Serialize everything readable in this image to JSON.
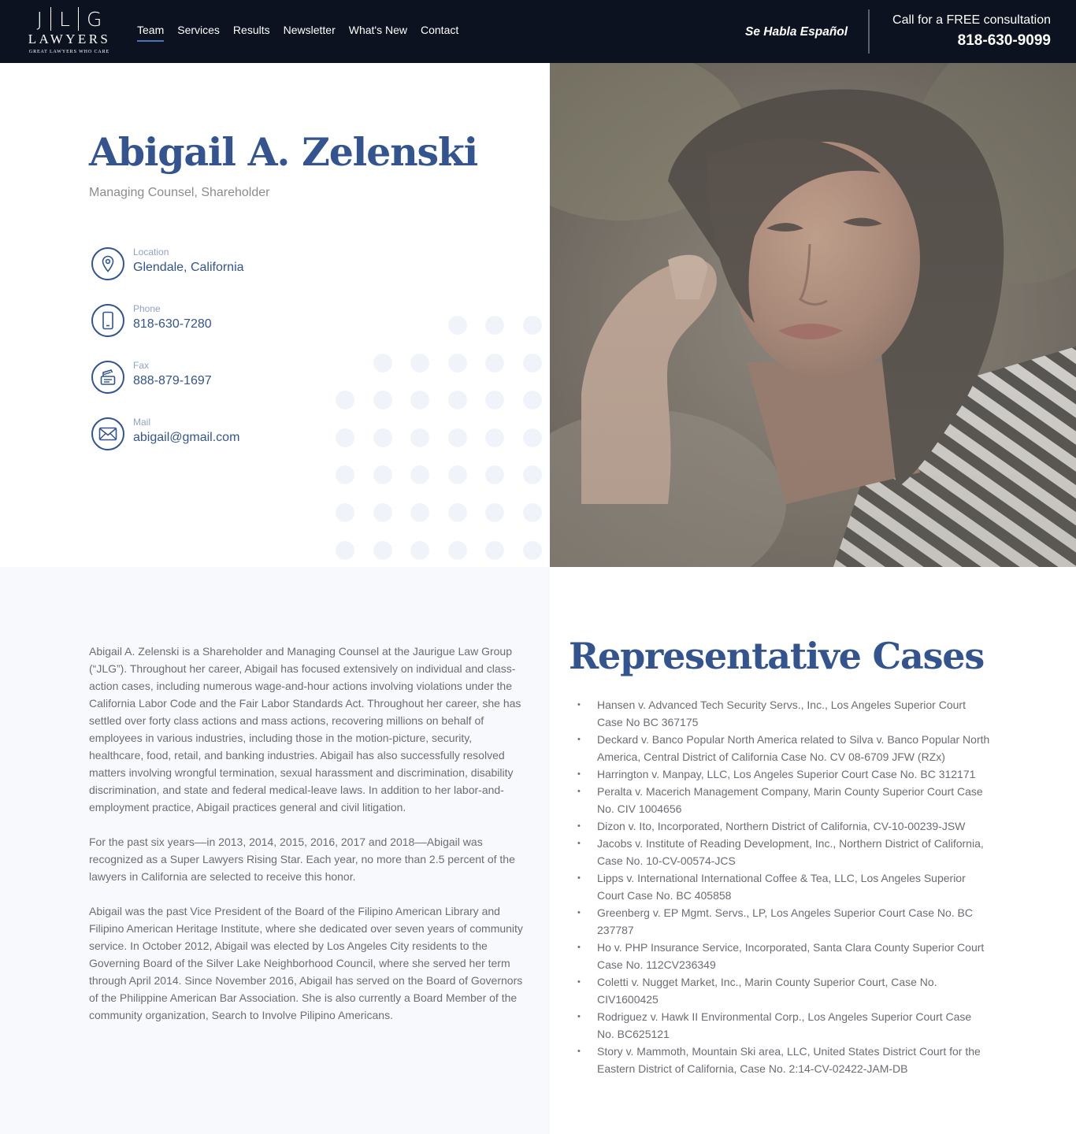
{
  "header": {
    "logo": {
      "mark_left": "J",
      "mark_center": "L",
      "mark_right": "G",
      "word": "LAWYERS",
      "tagline": "GREAT LAWYERS WHO CARE"
    },
    "nav": [
      {
        "label": "Team",
        "active": true
      },
      {
        "label": "Services"
      },
      {
        "label": "Results"
      },
      {
        "label": "Newsletter"
      },
      {
        "label": "What's New"
      },
      {
        "label": "Contact"
      }
    ],
    "spanish": "Se Habla Español",
    "cta_label": "Call for a FREE consultation",
    "cta_phone": "818-630-9099"
  },
  "profile": {
    "name": "Abigail A. Zelenski",
    "title": "Managing Counsel, Shareholder",
    "contacts": [
      {
        "label": "Location",
        "value": "Glendale, California",
        "icon": "location-pin-icon"
      },
      {
        "label": "Phone",
        "value": "818-630-7280",
        "icon": "mobile-phone-icon"
      },
      {
        "label": "Fax",
        "value": "888-879-1697",
        "icon": "fax-icon"
      },
      {
        "label": "Mail",
        "value": "abigail@gmail.com",
        "icon": "envelope-icon"
      }
    ]
  },
  "bio": [
    "Abigail A. Zelenski is a Shareholder and Managing Counsel at the Jaurigue Law Group (“JLG”). Throughout her career, Abigail has focused extensively on individual and class-action cases, including numerous wage-and-hour actions involving violations under the California Labor Code and the Fair Labor Standards Act. Throughout her career, she has settled over forty class actions and mass actions, recovering millions on behalf of employees in various industries, including those in the motion-picture, security, healthcare, food, retail, and banking industries. Abigail has also successfully resolved matters involving wrongful termination, sexual harassment and discrimination, disability discrimination, and state and federal medical-leave laws. In addition to her labor-and-employment practice, Abigail practices general and civil litigation.",
    "For the past six years––in 2013, 2014, 2015, 2016, 2017 and 2018––Abigail was recognized as a Super Lawyers Rising Star. Each year, no more than 2.5 percent of the lawyers in California are selected to receive this honor.",
    "Abigail was the past Vice President of the Board of the Filipino American Library and Filipino American Heritage Institute, where she dedicated over seven years of community service. In October 2012, Abigail was elected by Los Angeles City residents to the Governing Board of the Silver Lake Neighborhood Council, where she served her term through April 2014. Since November 2016, Abigail has served on the Board of Governors of the Philippine American Bar Association. She is also currently a Board Member of the community organization, Search to Involve Pilipino Americans."
  ],
  "cases": {
    "title": "Representative Cases",
    "items": [
      "Hansen v. Advanced Tech Security Servs., Inc., Los Angeles Superior Court Case No BC 367175",
      "Deckard v. Banco Popular North America related to Silva v. Banco Popular North America, Central District of California Case No. CV 08-6709 JFW (RZx)",
      "Harrington v. Manpay, LLC, Los Angeles Superior Court Case No. BC 312171",
      "Peralta v. Macerich Management Company, Marin County Superior Court Case No. CIV 1004656",
      "Dizon v. Ito, Incorporated, Northern District of California, CV-10-00239-JSW",
      "Jacobs v. Institute of Reading Development, Inc., Northern District of California, Case No. 10-CV-00574-JCS",
      "Lipps v. International International Coffee & Tea, LLC, Los Angeles Superior Court Case No. BC 405858",
      "Greenberg v. EP Mgmt. Servs., LP, Los Angeles Superior Court Case No. BC 237787",
      "Ho v. PHP Insurance Service, Incorporated, Santa Clara County Superior Court Case No. 112CV236349",
      "Coletti v. Nugget Market, Inc., Marin County Superior Court, Case No. CIV1600425",
      "Rodriguez v. Hawk II Environmental Corp., Los Angeles Superior Court Case No. BC625121",
      "Story v. Mammoth, Mountain Ski area, LLC, United States District Court for the Eastern District of California, Case No. 2:14-CV-02422-JAM-DB"
    ]
  },
  "colors": {
    "nav_bg": "#0d1220",
    "accent": "#33548f",
    "active_underline": "#4a73b8",
    "body_text": "#6a6d73"
  }
}
